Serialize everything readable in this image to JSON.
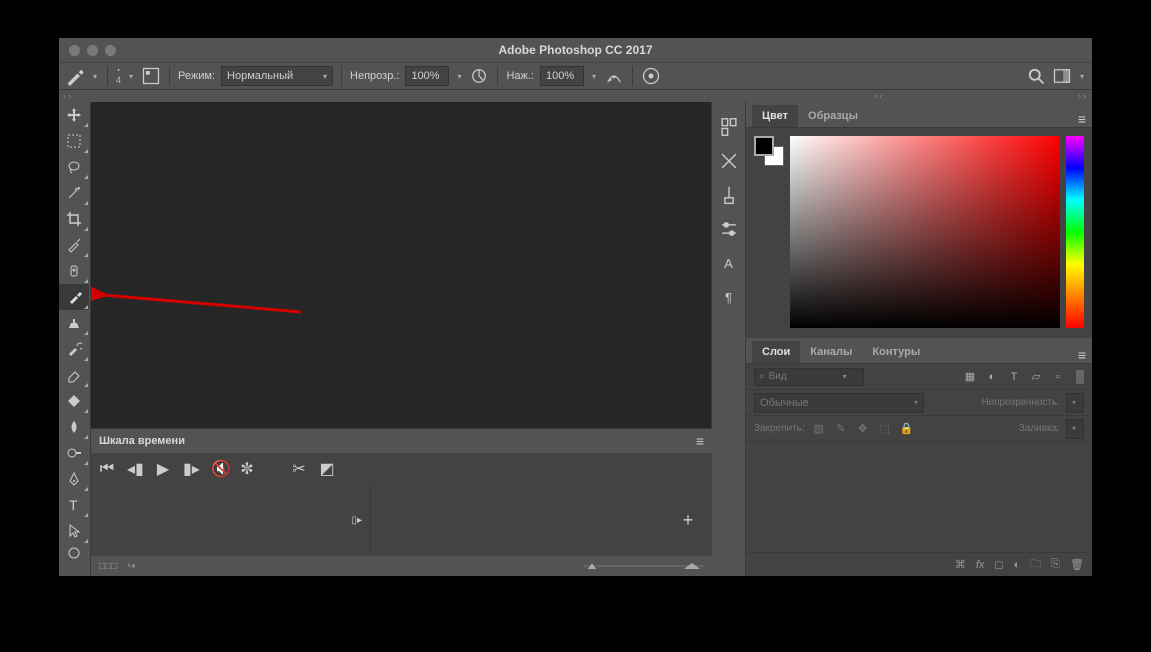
{
  "app": {
    "title": "Adobe Photoshop CC 2017"
  },
  "options_bar": {
    "brush_size": "4",
    "mode_label": "Режим:",
    "mode_value": "Нормальный",
    "opacity_label": "Непрозр.:",
    "opacity_value": "100%",
    "flow_label": "Наж.:",
    "flow_value": "100%"
  },
  "timeline": {
    "title": "Шкала времени",
    "footer_marks": "□□□"
  },
  "color_panel": {
    "tab_color": "Цвет",
    "tab_swatches": "Образцы"
  },
  "layers_panel": {
    "tab_layers": "Слои",
    "tab_channels": "Каналы",
    "tab_paths": "Контуры",
    "search_placeholder": "Вид",
    "blend_value": "Обычные",
    "opacity_label": "Непрозрачность:",
    "lock_label": "Закрепить:",
    "fill_label": "Заливка:"
  }
}
